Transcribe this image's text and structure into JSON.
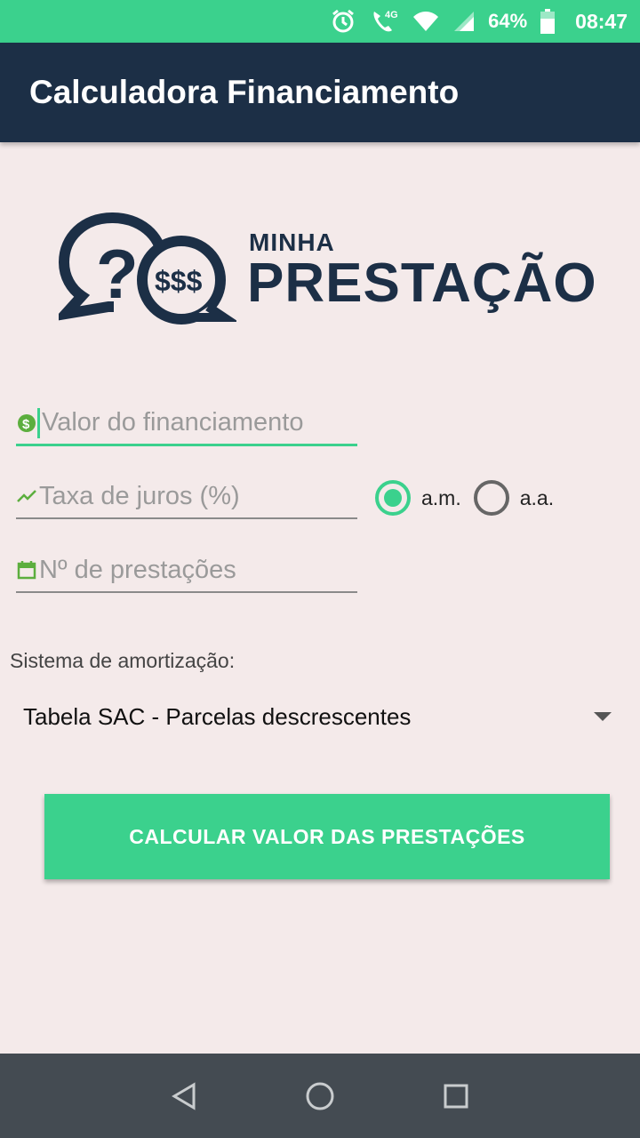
{
  "status_bar": {
    "battery_percent": "64%",
    "time": "08:47",
    "network_label": "4G",
    "icons": [
      "alarm-icon",
      "wifi-call-icon",
      "wifi-icon",
      "signal-icon",
      "battery-icon"
    ]
  },
  "app_bar": {
    "title": "Calculadora Financiamento"
  },
  "logo": {
    "small_text": "MINHA",
    "big_text": "PRESTAÇÃO",
    "bubble_symbols": "?",
    "money_symbols": "$$$"
  },
  "form": {
    "loan_amount": {
      "placeholder": "Valor do financiamento",
      "value": ""
    },
    "interest_rate": {
      "placeholder": "Taxa de juros (%)",
      "value": ""
    },
    "installments": {
      "placeholder": "Nº de prestações",
      "value": ""
    },
    "rate_period": {
      "options": [
        {
          "label": "a.m.",
          "checked": true
        },
        {
          "label": "a.a.",
          "checked": false
        }
      ]
    },
    "amortization": {
      "label": "Sistema de amortização:",
      "selected": "Tabela SAC - Parcelas descrescentes"
    },
    "calculate_label": "CALCULAR VALOR DAS PRESTAÇÕES"
  },
  "colors": {
    "accent": "#3bd18d",
    "app_bar": "#1c2f46",
    "background": "#f4eaea",
    "nav_bar": "#444b52"
  }
}
